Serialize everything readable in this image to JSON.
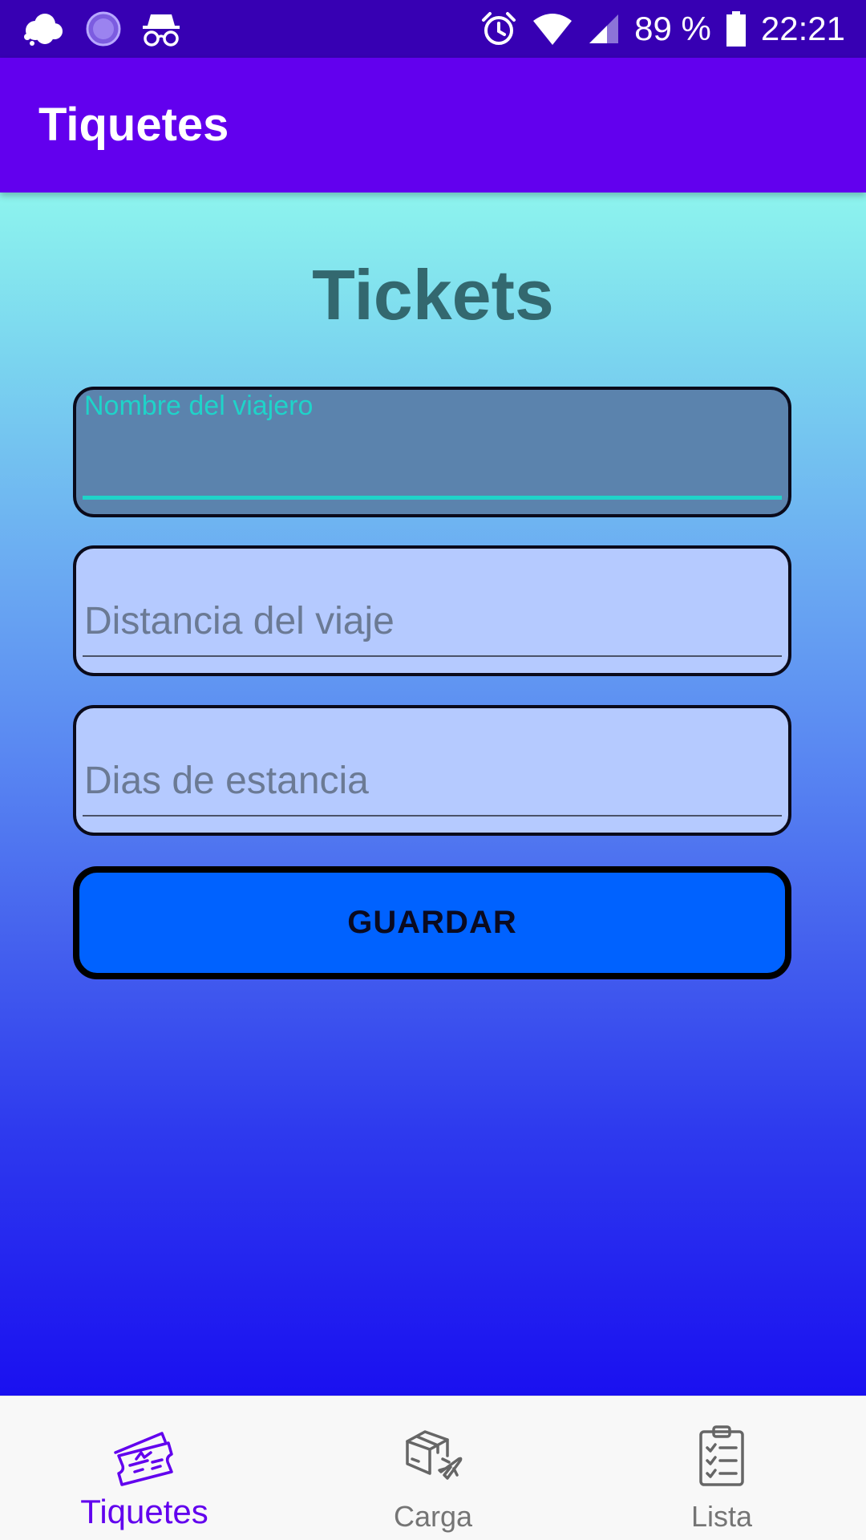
{
  "status_bar": {
    "battery_percent": "89 %",
    "time": "22:21",
    "left_icons": [
      "cloud-app-icon",
      "circle-app-icon",
      "incognito-icon"
    ],
    "right_icons": [
      "alarm-icon",
      "wifi-icon",
      "cell-signal-icon",
      "battery-icon"
    ]
  },
  "app_bar": {
    "title": "Tiquetes"
  },
  "main": {
    "title": "Tickets",
    "fields": {
      "traveler_name": {
        "label": "Nombre del viajero",
        "value": ""
      },
      "trip_distance": {
        "placeholder": "Distancia del viaje"
      },
      "stay_days": {
        "placeholder": "Dias de estancia"
      }
    },
    "save_button_label": "GUARDAR"
  },
  "bottom_nav": {
    "items": [
      {
        "label": "Tiquetes",
        "icon": "tickets-icon",
        "active": true
      },
      {
        "label": "Carga",
        "icon": "cargo-icon",
        "active": false
      },
      {
        "label": "Lista",
        "icon": "checklist-icon",
        "active": false
      }
    ]
  },
  "colors": {
    "status_bar": "#3700b3",
    "app_bar": "#6200ee",
    "accent": "#1fd3c9",
    "button": "#0062ff",
    "nav_active": "#6200ee",
    "nav_inactive": "#757575"
  }
}
